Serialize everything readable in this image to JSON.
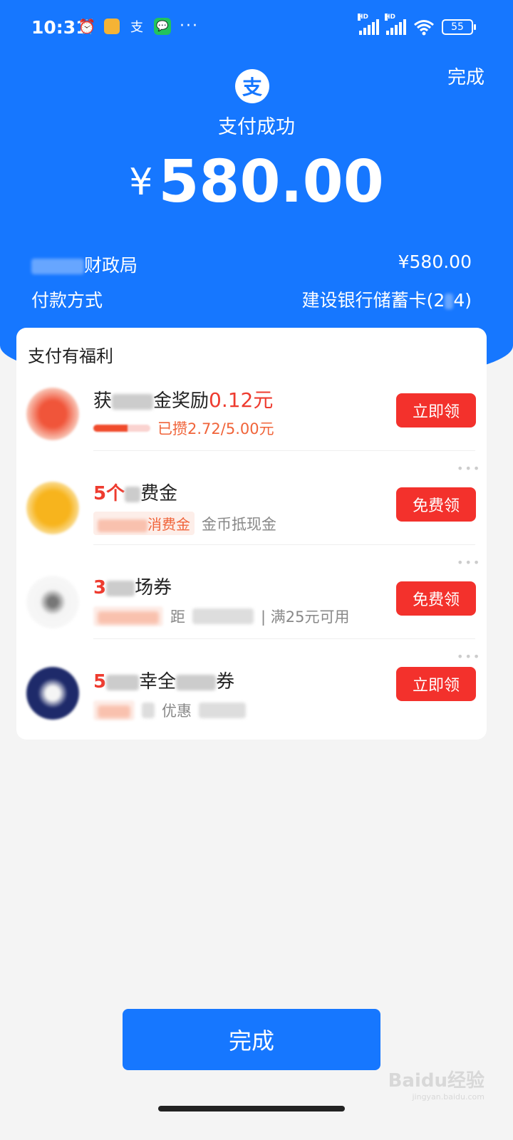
{
  "status_bar": {
    "time": "10:31",
    "battery": "55",
    "hd1": "HD",
    "hd2": "HD",
    "dots": "···"
  },
  "header": {
    "logo_char": "支",
    "done_label": "完成",
    "title": "支付成功",
    "currency": "¥",
    "amount": "580.00"
  },
  "details": {
    "payee_suffix": "财政局",
    "payee_amount": "¥580.00",
    "method_label": "付款方式",
    "method_value_prefix": "建设银行储蓄卡(2",
    "method_value_suffix": "4)"
  },
  "benefits": {
    "title": "支付有福利",
    "items": [
      {
        "title_a": "获",
        "title_b": "金奖励",
        "title_price": "0.12元",
        "sub_text": "已攒2.72/5.00元",
        "button": "立即领"
      },
      {
        "title_red": "5个",
        "title_b": "费金",
        "tag_visible": "消费金",
        "sub_text": "金币抵现金",
        "button": "免费领"
      },
      {
        "title_red": "3",
        "title_b": "场券",
        "sub_text_a": "距",
        "sub_text_b": "| 满25元可用",
        "button": "免费领"
      },
      {
        "title_red": "5",
        "title_b": "幸全",
        "title_c": "券",
        "sub_text_a": "",
        "sub_text_b": "优惠",
        "button": "立即领"
      }
    ]
  },
  "footer": {
    "done_button": "完成",
    "watermark": "Baidu经验",
    "watermark_sub": "jingyan.baidu.com"
  },
  "colors": {
    "brand_blue": "#1677ff",
    "red_button": "#f3312c",
    "price_red": "#ee3b2f"
  }
}
